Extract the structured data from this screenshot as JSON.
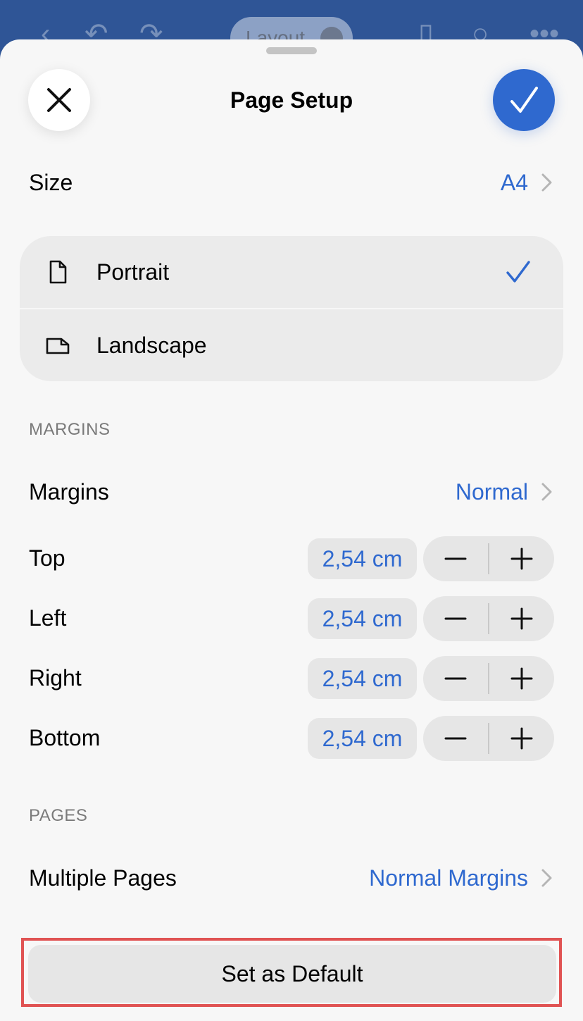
{
  "background": {
    "tab_label": "Layout"
  },
  "sheet": {
    "title": "Page Setup",
    "size": {
      "label": "Size",
      "value": "A4"
    },
    "orientation": {
      "options": [
        {
          "label": "Portrait",
          "selected": true
        },
        {
          "label": "Landscape",
          "selected": false
        }
      ]
    },
    "margins_header": "MARGINS",
    "margins": {
      "label": "Margins",
      "value": "Normal"
    },
    "margin_rows": [
      {
        "label": "Top",
        "value": "2,54 cm"
      },
      {
        "label": "Left",
        "value": "2,54 cm"
      },
      {
        "label": "Right",
        "value": "2,54 cm"
      },
      {
        "label": "Bottom",
        "value": "2,54 cm"
      }
    ],
    "pages_header": "PAGES",
    "multiple_pages": {
      "label": "Multiple Pages",
      "value": "Normal Margins"
    },
    "default_button": "Set as Default"
  },
  "colors": {
    "accent": "#2f69cf",
    "highlight_outline": "#e05353",
    "app_bar": "#2f5596"
  }
}
